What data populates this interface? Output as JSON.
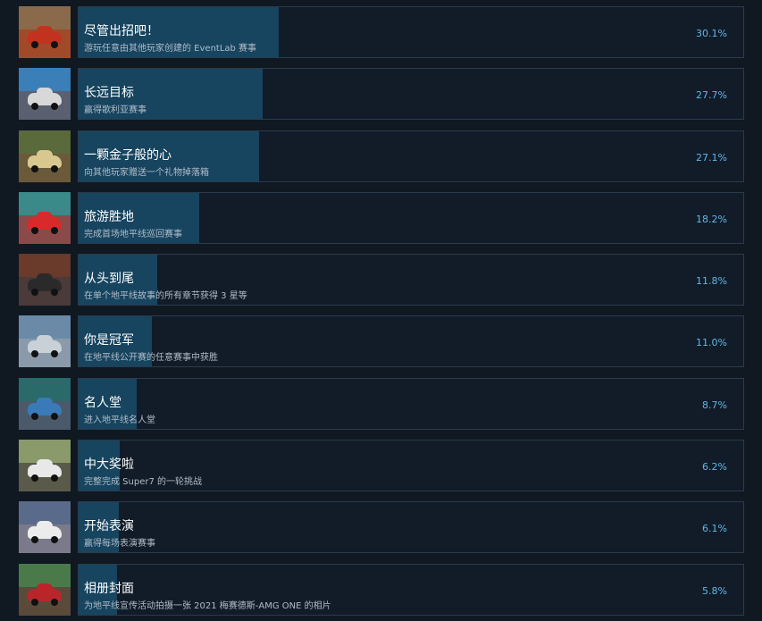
{
  "achievements": [
    {
      "title": "尽管出招吧！",
      "description": "游玩任意由其他玩家创建的 EventLab 赛事",
      "percent": "30.1%",
      "rate": 30.1,
      "icon": "red-sports-car-offroad-icon",
      "colors": {
        "sky": "#8a6a4a",
        "ground": "#a04a2a",
        "car": "#c2321e"
      }
    },
    {
      "title": "长远目标",
      "description": "赢得歌利亚赛事",
      "percent": "27.7%",
      "rate": 27.7,
      "icon": "race-cars-apex-banner-icon",
      "colors": {
        "sky": "#3a7fb8",
        "ground": "#5a6070",
        "car": "#d8d8d8"
      }
    },
    {
      "title": "一颗金子般的心",
      "description": "向其他玩家赠送一个礼物掉落箱",
      "percent": "27.1%",
      "rate": 27.1,
      "icon": "gold-luxury-car-icon",
      "colors": {
        "sky": "#5a6a3a",
        "ground": "#6a5a3a",
        "car": "#d8c890"
      }
    },
    {
      "title": "旅游胜地",
      "description": "完成首场地平线巡回赛事",
      "percent": "18.2%",
      "rate": 18.2,
      "icon": "red-car-festival-site-icon",
      "colors": {
        "sky": "#3a8a8a",
        "ground": "#8a4a4a",
        "car": "#d82a2a"
      }
    },
    {
      "title": "从头到尾",
      "description": "在单个地平线故事的所有章节获得 3 星等",
      "percent": "11.8%",
      "rate": 11.8,
      "icon": "dark-muscle-car-icon",
      "colors": {
        "sky": "#6a3a2a",
        "ground": "#4a3a3a",
        "car": "#2a2a2a"
      }
    },
    {
      "title": "你是冠军",
      "description": "在地平线公开赛的任意赛事中获胜",
      "percent": "11.0%",
      "rate": 11.0,
      "icon": "silver-supercar-icon",
      "colors": {
        "sky": "#6a8aa8",
        "ground": "#8a9aaa",
        "car": "#c8d0d8"
      }
    },
    {
      "title": "名人堂",
      "description": "进入地平线名人堂",
      "percent": "8.7%",
      "rate": 8.7,
      "icon": "blue-supercar-plaza-icon",
      "colors": {
        "sky": "#2a6a6a",
        "ground": "#4a5a6a",
        "car": "#3a7ab8"
      }
    },
    {
      "title": "中大奖啦",
      "description": "完整完成 Super7 的一轮挑战",
      "percent": "6.2%",
      "rate": 6.2,
      "icon": "white-police-car-jump-icon",
      "colors": {
        "sky": "#8a9a6a",
        "ground": "#5a5a4a",
        "car": "#e8e8e8"
      }
    },
    {
      "title": "开始表演",
      "description": "赢得每场表演赛事",
      "percent": "6.1%",
      "rate": 6.1,
      "icon": "white-wedge-supercar-icon",
      "colors": {
        "sky": "#5a6a8a",
        "ground": "#7a7a8a",
        "car": "#ececec"
      }
    },
    {
      "title": "相册封面",
      "description": "为地平线宣传活动拍摄一张 2021 梅赛德斯-AMG ONE 的相片",
      "percent": "5.8%",
      "rate": 5.8,
      "icon": "red-hypercar-mountain-icon",
      "colors": {
        "sky": "#4a7a4a",
        "ground": "#5a4a3a",
        "car": "#b8262a"
      }
    }
  ]
}
